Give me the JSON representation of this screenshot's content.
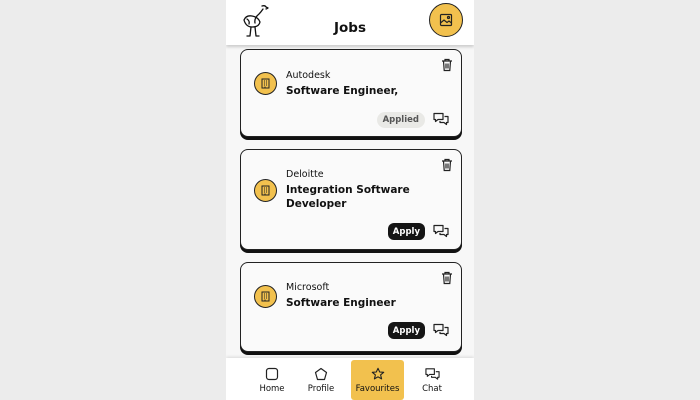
{
  "header": {
    "title": "Jobs",
    "logo_icon": "ostrich-logo-icon",
    "profile_icon": "profile-picture-icon"
  },
  "jobs": [
    {
      "company": "Autodesk",
      "role": "Software Engineer,",
      "status": "Applied"
    },
    {
      "company": "Deloitte",
      "role": "Integration Software Developer",
      "status": "Apply"
    },
    {
      "company": "Microsoft",
      "role": "Software Engineer",
      "status": "Apply"
    }
  ],
  "nav": {
    "items": [
      {
        "label": "Home",
        "icon": "home-icon"
      },
      {
        "label": "Profile",
        "icon": "pentagon-icon"
      },
      {
        "label": "Favourites",
        "icon": "star-icon",
        "active": true
      },
      {
        "label": "Chat",
        "icon": "chat-icon"
      }
    ]
  },
  "colors": {
    "accent": "#f2c14e",
    "dark": "#151515",
    "background": "#f7f7f7"
  }
}
